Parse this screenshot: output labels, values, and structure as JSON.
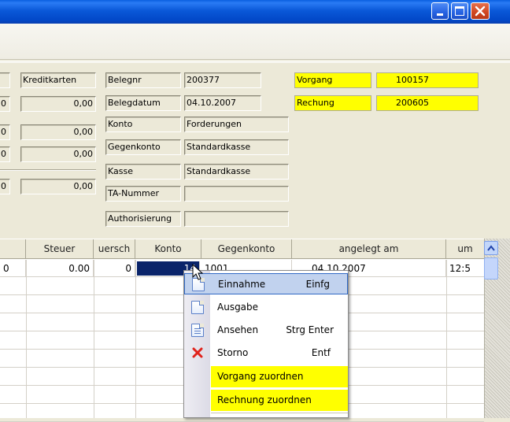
{
  "window": {
    "title": "",
    "buttons": {
      "minimize": "minimize-icon",
      "maximize": "maximize-icon",
      "close": "close-icon"
    }
  },
  "summary": {
    "kreditkarten_label": "Kreditkarten",
    "row_values": [
      "0,00",
      "0,00",
      "0,00",
      "0,00"
    ],
    "left_partial": [
      "0",
      "0",
      "0",
      "0"
    ]
  },
  "beleg": {
    "belegnr_label": "Belegnr",
    "belegnr_value": "200377",
    "belegdatum_label": "Belegdatum",
    "belegdatum_value": "04.10.2007",
    "konto_label": "Konto",
    "konto_value": "Forderungen",
    "gegenkonto_label": "Gegenkonto",
    "gegenkonto_value": "Standardkasse",
    "kasse_label": "Kasse",
    "kasse_value": "Standardkasse",
    "ta_label": "TA-Nummer",
    "ta_value": "",
    "auth_label": "Authorisierung",
    "auth_value": ""
  },
  "links": {
    "vorgang_label": "Vorgang",
    "vorgang_value": "100157",
    "rechnung_label": "Rechung",
    "rechnung_value": "200605",
    "highlight_color": "#ffff00"
  },
  "grid": {
    "columns": [
      "",
      "Steuer",
      "uersch",
      "Konto",
      "Gegenkonto",
      "angelegt am",
      "um"
    ],
    "rows": [
      {
        "c0": "0",
        "steuer": "0.00",
        "uersch": "0",
        "konto": "14",
        "gegenkonto": "1001",
        "angelegt": "04.10.2007",
        "um": "12:5"
      }
    ]
  },
  "context_menu": {
    "items": [
      {
        "label": "Einnahme",
        "shortcut": "Einfg",
        "icon": "new-document-icon"
      },
      {
        "label": "Ausgabe",
        "shortcut": "",
        "icon": "document-icon"
      },
      {
        "label": "Ansehen",
        "shortcut": "Strg Enter",
        "icon": "view-document-icon"
      },
      {
        "label": "Storno",
        "shortcut": "Entf",
        "icon": "cancel-x-icon"
      },
      {
        "label": "Vorgang zuordnen",
        "shortcut": ""
      },
      {
        "label": "Rechnung zuordnen",
        "shortcut": ""
      }
    ]
  }
}
